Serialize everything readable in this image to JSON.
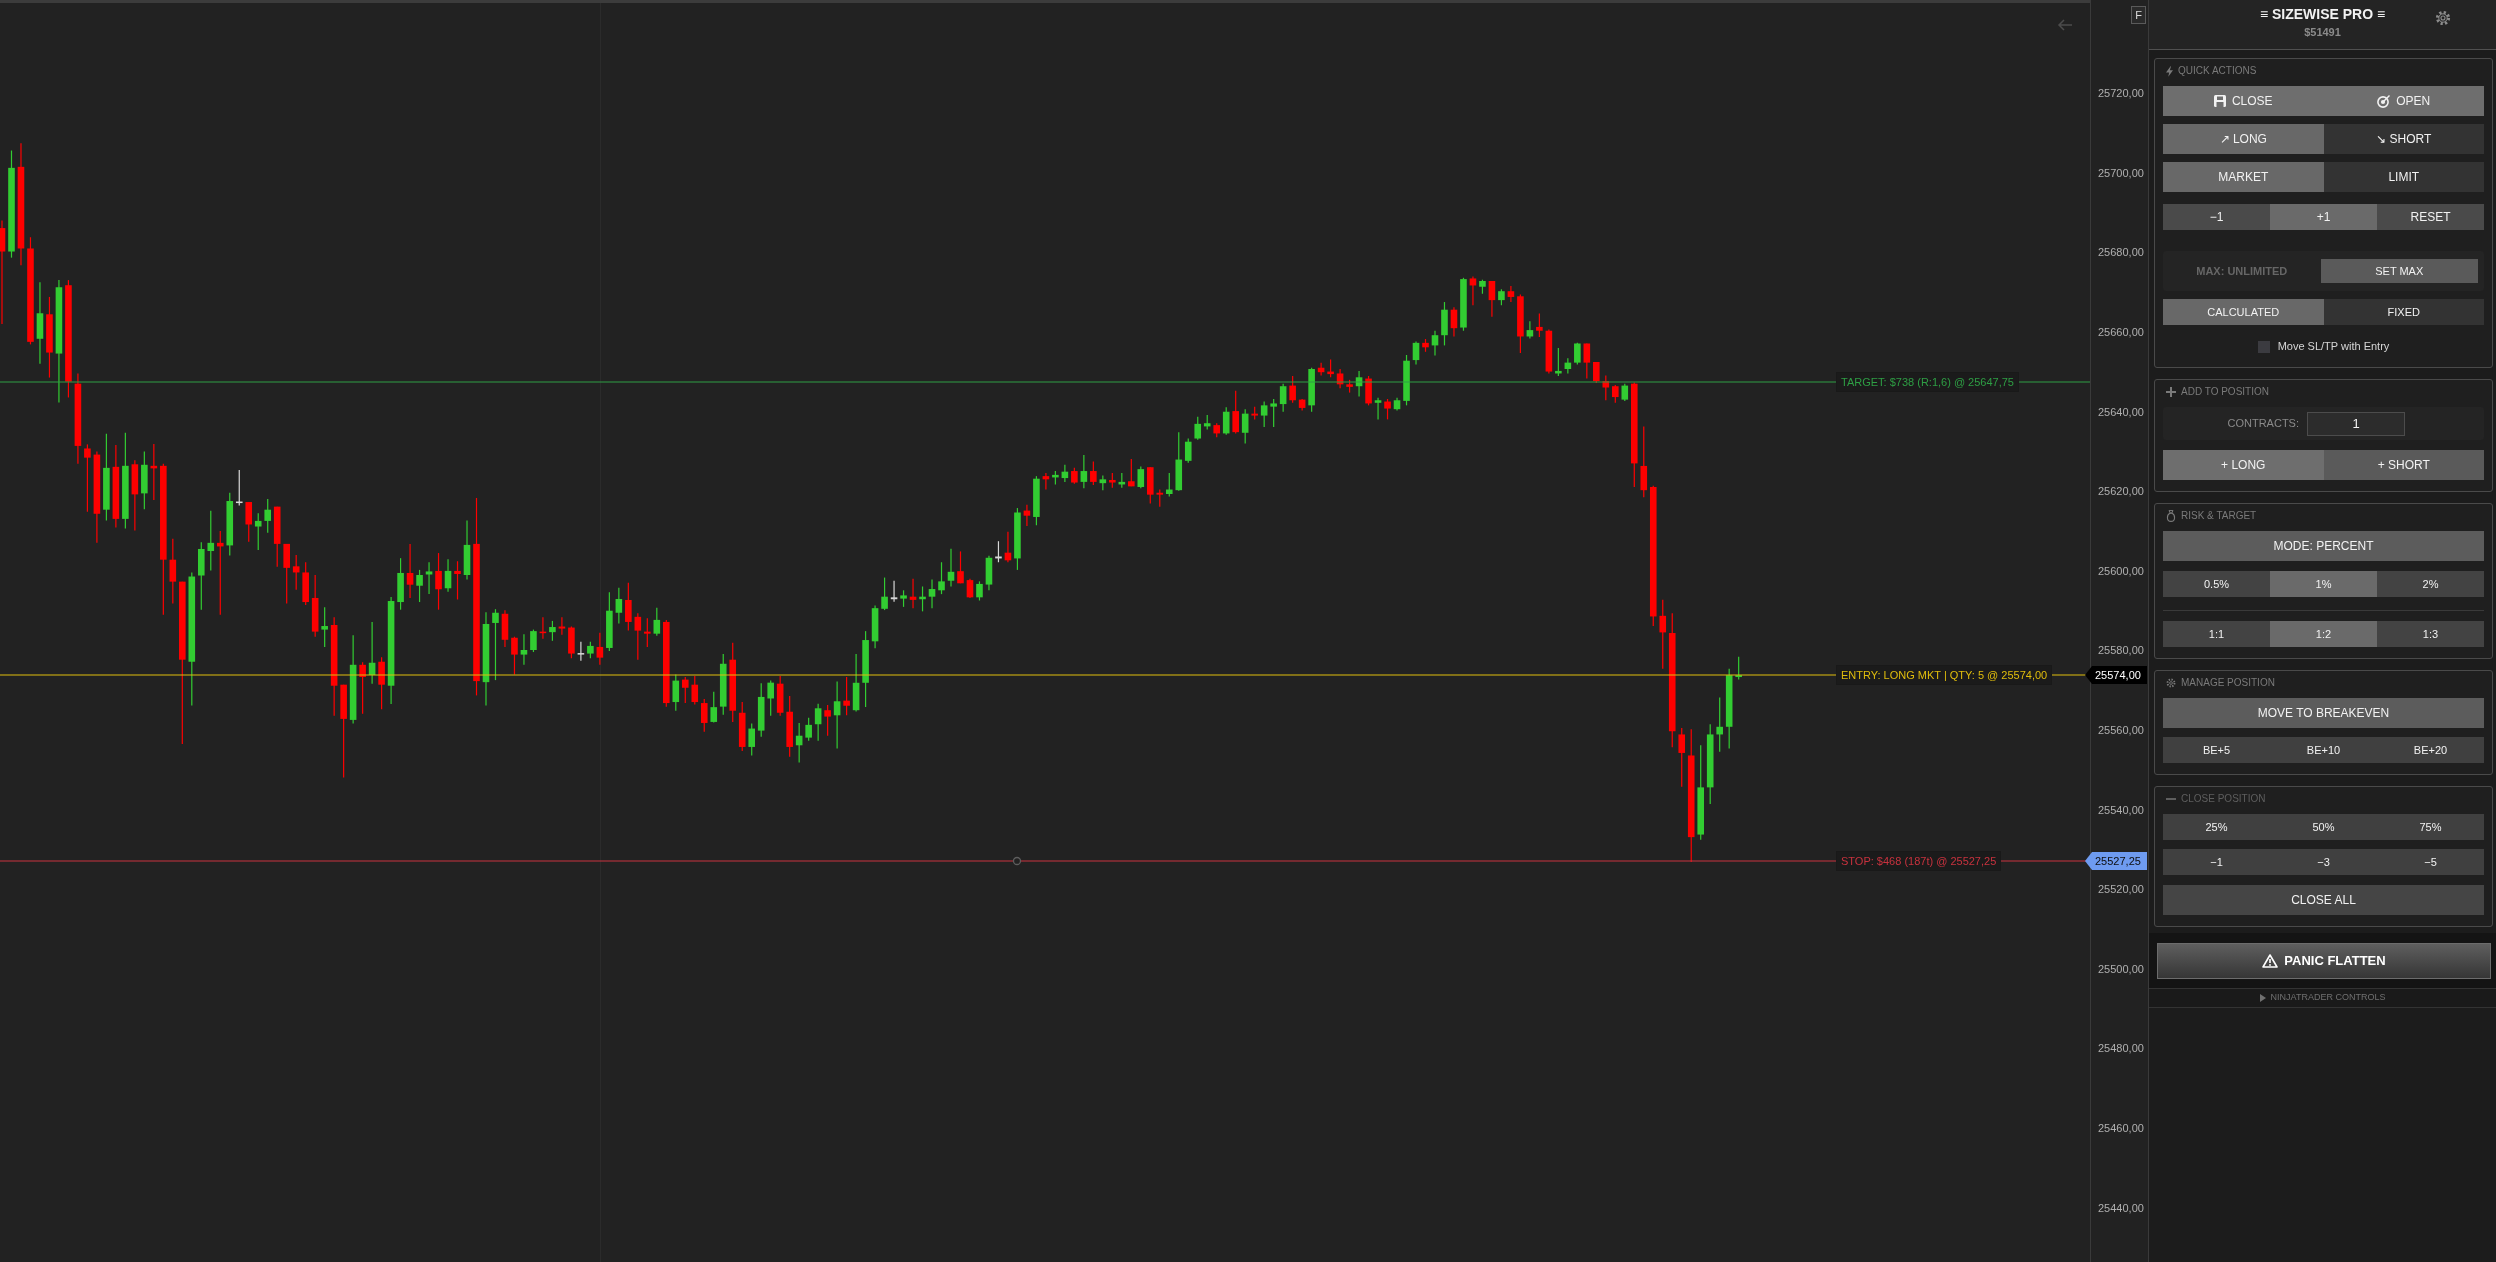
{
  "chart": {
    "corner_button": "F",
    "levels": [
      {
        "kind": "target",
        "label": "TARGET: $738 (R:1,6) @ 25647,75",
        "color": "#2e9e44"
      },
      {
        "kind": "entry",
        "label": "ENTRY: LONG MKT | QTY: 5 @ 25574,00",
        "color": "#e0bd0c"
      },
      {
        "kind": "stop",
        "label": "STOP: $468 (187t) @ 25527,25",
        "color": "#c8323e"
      }
    ],
    "price_axis": {
      "labels": [
        "25720,00",
        "25700,00",
        "25680,00",
        "25660,00",
        "25640,00",
        "25620,00",
        "25600,00",
        "25580,00",
        "25560,00",
        "25540,00",
        "25520,00",
        "25500,00",
        "25480,00",
        "25460,00",
        "25440,00"
      ],
      "markers": [
        {
          "kind": "current",
          "text": "25574,00"
        },
        {
          "kind": "stop",
          "text": "25527,25"
        }
      ]
    }
  },
  "panel": {
    "title": "≡ SIZEWISE PRO ≡",
    "balance": "$51491",
    "sections": [
      {
        "kind": "quick",
        "title": "QUICK ACTIONS",
        "dimmed": false,
        "rows": [
          {
            "kind": "pair",
            "buttons": [
              {
                "kind": "close",
                "label": "CLOSE",
                "highlighted": true
              },
              {
                "kind": "open",
                "label": "OPEN",
                "highlighted": true
              }
            ]
          },
          {
            "kind": "toggle",
            "buttons": [
              {
                "label": "↗ LONG",
                "selected": true
              },
              {
                "label": "↘ SHORT",
                "selected": false
              }
            ]
          },
          {
            "kind": "toggle",
            "buttons": [
              {
                "label": "MARKET",
                "selected": true
              },
              {
                "label": "LIMIT",
                "selected": false
              }
            ]
          },
          {
            "kind": "stepper",
            "buttons": [
              {
                "label": "−1",
                "highlighted": false
              },
              {
                "label": "+1",
                "highlighted": true
              },
              {
                "label": "RESET",
                "highlighted": false
              }
            ]
          },
          {
            "kind": "max",
            "status": "MAX: UNLIMITED",
            "button": "SET MAX"
          },
          {
            "kind": "mode",
            "buttons": [
              {
                "label": "CALCULATED",
                "selected": true
              },
              {
                "label": "FIXED",
                "selected": false
              }
            ]
          },
          {
            "kind": "checkbox",
            "label": "Move SL/TP with Entry",
            "checked": false
          }
        ]
      },
      {
        "kind": "add",
        "title": "ADD TO POSITION",
        "dimmed": false,
        "rows": [
          {
            "kind": "contracts",
            "label": "CONTRACTS:",
            "value": "1"
          },
          {
            "kind": "pair",
            "buttons": [
              {
                "kind": "plain",
                "label": "+ LONG",
                "highlighted": true
              },
              {
                "kind": "plain",
                "label": "+ SHORT",
                "highlighted": false
              }
            ]
          }
        ]
      },
      {
        "kind": "risk",
        "title": "RISK & TARGET",
        "dimmed": false,
        "rows": [
          {
            "kind": "action",
            "label": "MODE: PERCENT",
            "highlighted": true
          },
          {
            "kind": "choice",
            "buttons": [
              {
                "label": "0.5%",
                "selected": false
              },
              {
                "label": "1%",
                "selected": true
              },
              {
                "label": "2%",
                "selected": false
              }
            ]
          },
          {
            "kind": "divider"
          },
          {
            "kind": "choice",
            "buttons": [
              {
                "label": "1:1",
                "selected": false
              },
              {
                "label": "1:2",
                "selected": true
              },
              {
                "label": "1:3",
                "selected": false
              }
            ]
          }
        ]
      },
      {
        "kind": "manage",
        "title": "MANAGE POSITION",
        "dimmed": false,
        "rows": [
          {
            "kind": "action",
            "label": "MOVE TO BREAKEVEN",
            "highlighted": true
          },
          {
            "kind": "grid",
            "buttons": [
              "BE+5",
              "BE+10",
              "BE+20"
            ]
          }
        ]
      },
      {
        "kind": "close",
        "title": "CLOSE POSITION",
        "dimmed": true,
        "rows": [
          {
            "kind": "grid",
            "buttons": [
              "25%",
              "50%",
              "75%"
            ]
          },
          {
            "kind": "grid",
            "buttons": [
              "−1",
              "−3",
              "−5"
            ]
          },
          {
            "kind": "action",
            "label": "CLOSE ALL",
            "highlighted": false
          }
        ]
      }
    ],
    "panic_button": "PANIC FLATTEN",
    "controls_toggle": {
      "label": "NINJATRADER CONTROLS",
      "expanded": false
    }
  }
}
